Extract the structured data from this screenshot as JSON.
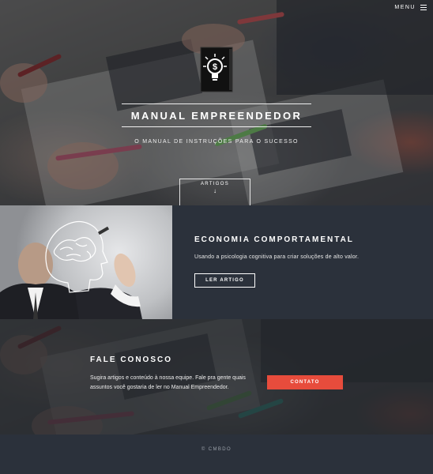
{
  "nav": {
    "menu_label": "MENU",
    "menu_icon": "hamburger-icon"
  },
  "hero": {
    "logo_icon": "lightbulb-dollar-book-icon",
    "title": "MANUAL EMPREENDEDOR",
    "subtitle": "O MANUAL DE INSTRUÇÕES PARA O SUCESSO",
    "articles_label": "ARTIGOS",
    "articles_arrow": "↓"
  },
  "feature": {
    "image_icon": "man-drawing-brain-image",
    "title": "ECONOMIA COMPORTAMENTAL",
    "description": "Usando a psicologia cognitiva para criar soluções de alto valor.",
    "button_label": "LER ARTIGO"
  },
  "contact": {
    "title": "FALE CONOSCO",
    "description": "Sugira artigos e conteúdo à nossa equipe. Fale pra gente quais assuntos você gostaria de ler no Manual Empreendedor.",
    "button_label": "CONTATO",
    "button_color": "#e74c3c"
  },
  "footer": {
    "text": "© CMBDO"
  },
  "colors": {
    "panel": "#2b313b",
    "accent": "#e74c3c"
  }
}
